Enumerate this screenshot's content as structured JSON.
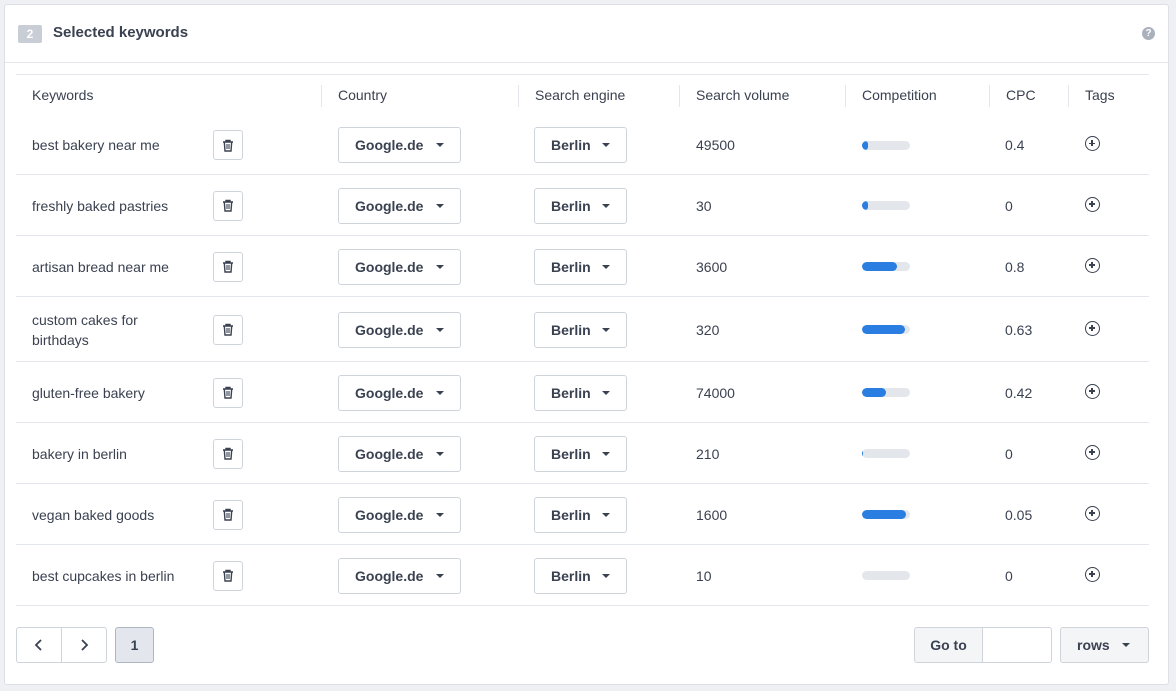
{
  "panel": {
    "step": "2",
    "title": "Selected keywords",
    "help": "?"
  },
  "columns": {
    "keywords": "Keywords",
    "country": "Country",
    "engine": "Search engine",
    "volume": "Search volume",
    "competition": "Competition",
    "cpc": "CPC",
    "tags": "Tags"
  },
  "rows": [
    {
      "keyword": "best bakery near me",
      "country": "Google.de",
      "engine": "Berlin",
      "volume": "49500",
      "competition": 0.12,
      "cpc": "0.4"
    },
    {
      "keyword": "freshly baked pastries",
      "country": "Google.de",
      "engine": "Berlin",
      "volume": "30",
      "competition": 0.12,
      "cpc": "0"
    },
    {
      "keyword": "artisan bread near me",
      "country": "Google.de",
      "engine": "Berlin",
      "volume": "3600",
      "competition": 0.72,
      "cpc": "0.8"
    },
    {
      "keyword": "custom cakes for birthdays",
      "country": "Google.de",
      "engine": "Berlin",
      "volume": "320",
      "competition": 0.9,
      "cpc": "0.63"
    },
    {
      "keyword": "gluten-free bakery",
      "country": "Google.de",
      "engine": "Berlin",
      "volume": "74000",
      "competition": 0.5,
      "cpc": "0.42"
    },
    {
      "keyword": "bakery in berlin",
      "country": "Google.de",
      "engine": "Berlin",
      "volume": "210",
      "competition": 0.02,
      "cpc": "0"
    },
    {
      "keyword": "vegan baked goods",
      "country": "Google.de",
      "engine": "Berlin",
      "volume": "1600",
      "competition": 0.92,
      "cpc": "0.05"
    },
    {
      "keyword": "best cupcakes in berlin",
      "country": "Google.de",
      "engine": "Berlin",
      "volume": "10",
      "competition": 0.0,
      "cpc": "0"
    }
  ],
  "pagination": {
    "current_page": "1",
    "goto_label": "Go to",
    "goto_value": "",
    "rows_label": "rows"
  },
  "colors": {
    "accent": "#2a7de1",
    "track": "#e3e7ec"
  }
}
